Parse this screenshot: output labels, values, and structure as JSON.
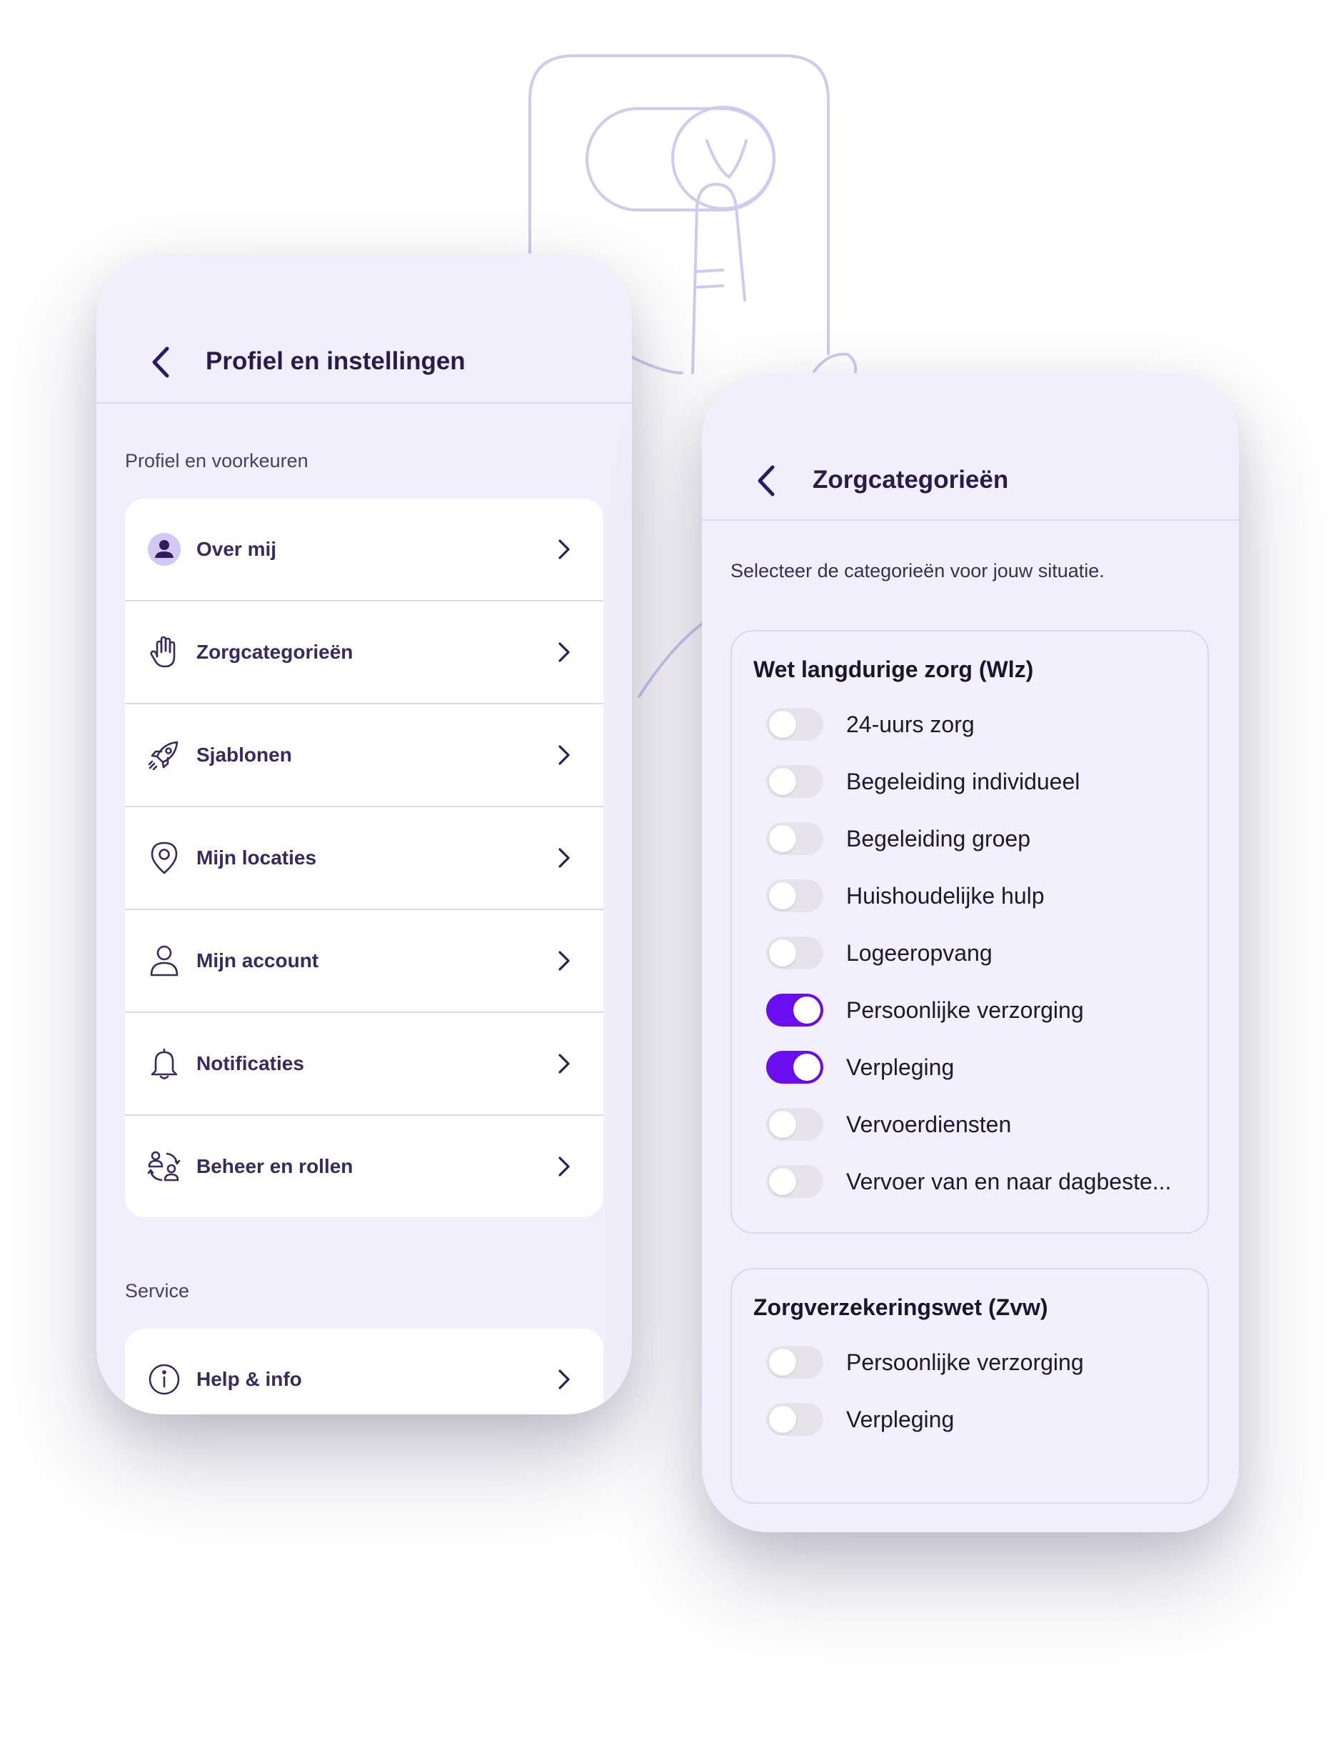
{
  "colors": {
    "accent": "#6a0df0",
    "panel_bg": "#f2effc",
    "text_dark": "#2a1c4a",
    "line_art": "#d2c8f0"
  },
  "settings_screen": {
    "back_icon": "chevron-left-icon",
    "title": "Profiel en instellingen",
    "sections": [
      {
        "label": "Profiel en voorkeuren",
        "items": [
          {
            "label": "Over mij",
            "icon": "user-avatar-icon"
          },
          {
            "label": "Zorgcategorieën",
            "icon": "hand-icon"
          },
          {
            "label": "Sjablonen",
            "icon": "rocket-icon"
          },
          {
            "label": "Mijn locaties",
            "icon": "location-pin-icon"
          },
          {
            "label": "Mijn account",
            "icon": "person-outline-icon"
          },
          {
            "label": "Notificaties",
            "icon": "bell-icon"
          },
          {
            "label": "Beheer en rollen",
            "icon": "users-manage-icon"
          }
        ]
      },
      {
        "label": "Service",
        "items": [
          {
            "label": "Help & info",
            "icon": "info-icon"
          }
        ]
      }
    ]
  },
  "categories_screen": {
    "back_icon": "chevron-left-icon",
    "title": "Zorgcategorieën",
    "intro": "Selecteer de categorieën voor jouw situatie.",
    "groups": [
      {
        "title": "Wet langdurige zorg (Wlz)",
        "items": [
          {
            "label": "24-uurs zorg",
            "on": false
          },
          {
            "label": "Begeleiding individueel",
            "on": false
          },
          {
            "label": "Begeleiding groep",
            "on": false
          },
          {
            "label": "Huishoudelijke hulp",
            "on": false
          },
          {
            "label": "Logeeropvang",
            "on": false
          },
          {
            "label": "Persoonlijke verzorging",
            "on": true
          },
          {
            "label": "Verpleging",
            "on": true
          },
          {
            "label": "Vervoerdiensten",
            "on": false
          },
          {
            "label": "Vervoer van en naar dagbeste...",
            "on": false
          }
        ]
      },
      {
        "title": "Zorgverzekeringswet (Zvw)",
        "items": [
          {
            "label": "Persoonlijke verzorging",
            "on": false
          },
          {
            "label": "Verpleging",
            "on": false
          }
        ]
      }
    ]
  }
}
